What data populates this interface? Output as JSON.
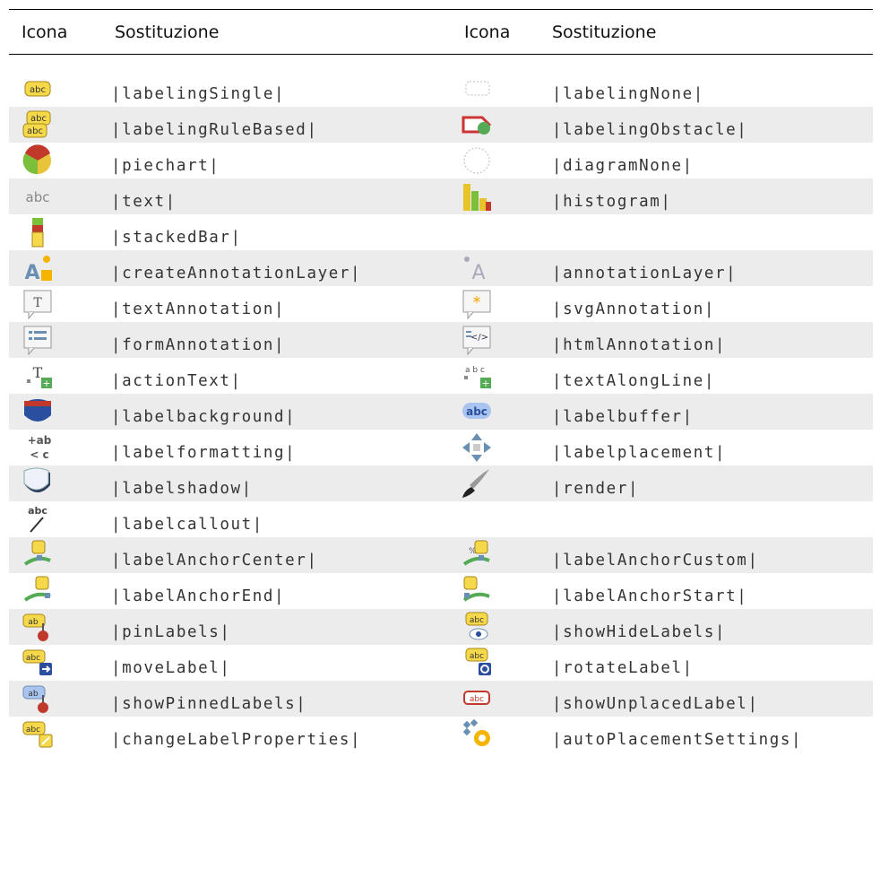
{
  "header": {
    "icon_col_1": "Icona",
    "sub_col_1": "Sostituzione",
    "icon_col_2": "Icona",
    "sub_col_2": "Sostituzione"
  },
  "rows": [
    {
      "left": {
        "icon": "labeling-single-icon",
        "code": "|labelingSingle|"
      },
      "right": {
        "icon": "labeling-none-icon",
        "code": "|labelingNone|"
      }
    },
    {
      "left": {
        "icon": "labeling-rule-based-icon",
        "code": "|labelingRuleBased|"
      },
      "right": {
        "icon": "labeling-obstacle-icon",
        "code": "|labelingObstacle|"
      }
    },
    {
      "left": {
        "icon": "piechart-icon",
        "code": "|piechart|"
      },
      "right": {
        "icon": "diagram-none-icon",
        "code": "|diagramNone|"
      }
    },
    {
      "left": {
        "icon": "text-icon",
        "code": "|text|",
        "glyph": "abc"
      },
      "right": {
        "icon": "histogram-icon",
        "code": "|histogram|"
      }
    },
    {
      "left": {
        "icon": "stacked-bar-icon",
        "code": "|stackedBar|"
      },
      "right": {
        "icon": "",
        "code": ""
      }
    },
    {
      "left": {
        "icon": "create-annotation-layer-icon",
        "code": "|createAnnotationLayer|"
      },
      "right": {
        "icon": "annotation-layer-icon",
        "code": "|annotationLayer|"
      }
    },
    {
      "left": {
        "icon": "text-annotation-icon",
        "code": "|textAnnotation|"
      },
      "right": {
        "icon": "svg-annotation-icon",
        "code": "|svgAnnotation|"
      }
    },
    {
      "left": {
        "icon": "form-annotation-icon",
        "code": "|formAnnotation|"
      },
      "right": {
        "icon": "html-annotation-icon",
        "code": "|htmlAnnotation|"
      }
    },
    {
      "left": {
        "icon": "action-text-icon",
        "code": "|actionText|"
      },
      "right": {
        "icon": "text-along-line-icon",
        "code": "|textAlongLine|"
      }
    },
    {
      "left": {
        "icon": "label-background-icon",
        "code": "|labelbackground|"
      },
      "right": {
        "icon": "label-buffer-icon",
        "code": "|labelbuffer|"
      }
    },
    {
      "left": {
        "icon": "label-formatting-icon",
        "code": "|labelformatting|"
      },
      "right": {
        "icon": "label-placement-icon",
        "code": "|labelplacement|"
      }
    },
    {
      "left": {
        "icon": "label-shadow-icon",
        "code": "|labelshadow|"
      },
      "right": {
        "icon": "render-icon",
        "code": "|render|"
      }
    },
    {
      "left": {
        "icon": "label-callout-icon",
        "code": "|labelcallout|"
      },
      "right": {
        "icon": "",
        "code": ""
      }
    },
    {
      "left": {
        "icon": "label-anchor-center-icon",
        "code": "|labelAnchorCenter|"
      },
      "right": {
        "icon": "label-anchor-custom-icon",
        "code": "|labelAnchorCustom|"
      }
    },
    {
      "left": {
        "icon": "label-anchor-end-icon",
        "code": "|labelAnchorEnd|"
      },
      "right": {
        "icon": "label-anchor-start-icon",
        "code": "|labelAnchorStart|"
      }
    },
    {
      "left": {
        "icon": "pin-labels-icon",
        "code": "|pinLabels|"
      },
      "right": {
        "icon": "show-hide-labels-icon",
        "code": "|showHideLabels|"
      }
    },
    {
      "left": {
        "icon": "move-label-icon",
        "code": "|moveLabel|"
      },
      "right": {
        "icon": "rotate-label-icon",
        "code": "|rotateLabel|"
      }
    },
    {
      "left": {
        "icon": "show-pinned-labels-icon",
        "code": "|showPinnedLabels|"
      },
      "right": {
        "icon": "show-unplaced-label-icon",
        "code": "|showUnplacedLabel|"
      }
    },
    {
      "left": {
        "icon": "change-label-properties-icon",
        "code": "|changeLabelProperties|"
      },
      "right": {
        "icon": "auto-placement-settings-icon",
        "code": "|autoPlacementSettings|"
      }
    }
  ],
  "colors": {
    "row_alt": "#ececec",
    "tag_yellow": "#f5d94a",
    "tag_border": "#a8861b"
  }
}
